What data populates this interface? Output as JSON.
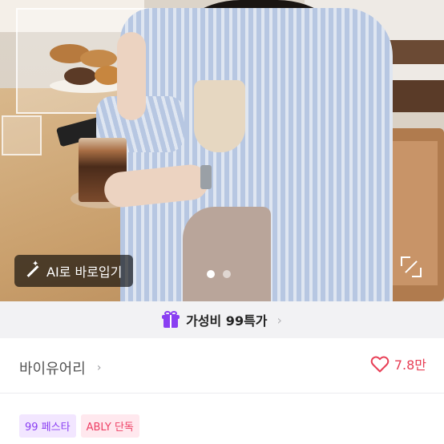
{
  "hero": {
    "ai_button_label": "AI로 바로입기",
    "ai_icon": "magic-wand-icon",
    "carousel": {
      "total": 2,
      "active_index": 0
    },
    "expand_icon": "expand-icon"
  },
  "promo": {
    "icon": "gift-icon",
    "label": "가성비 99특가",
    "chevron": "›"
  },
  "brand": {
    "name": "바이유어리",
    "chevron": "›",
    "likes": "7.8만",
    "like_icon": "heart-icon"
  },
  "tags": [
    {
      "label": "99 페스타",
      "color": "#8a3ff2"
    },
    {
      "label": "ABLY 단독",
      "color": "#ee3f64"
    }
  ]
}
